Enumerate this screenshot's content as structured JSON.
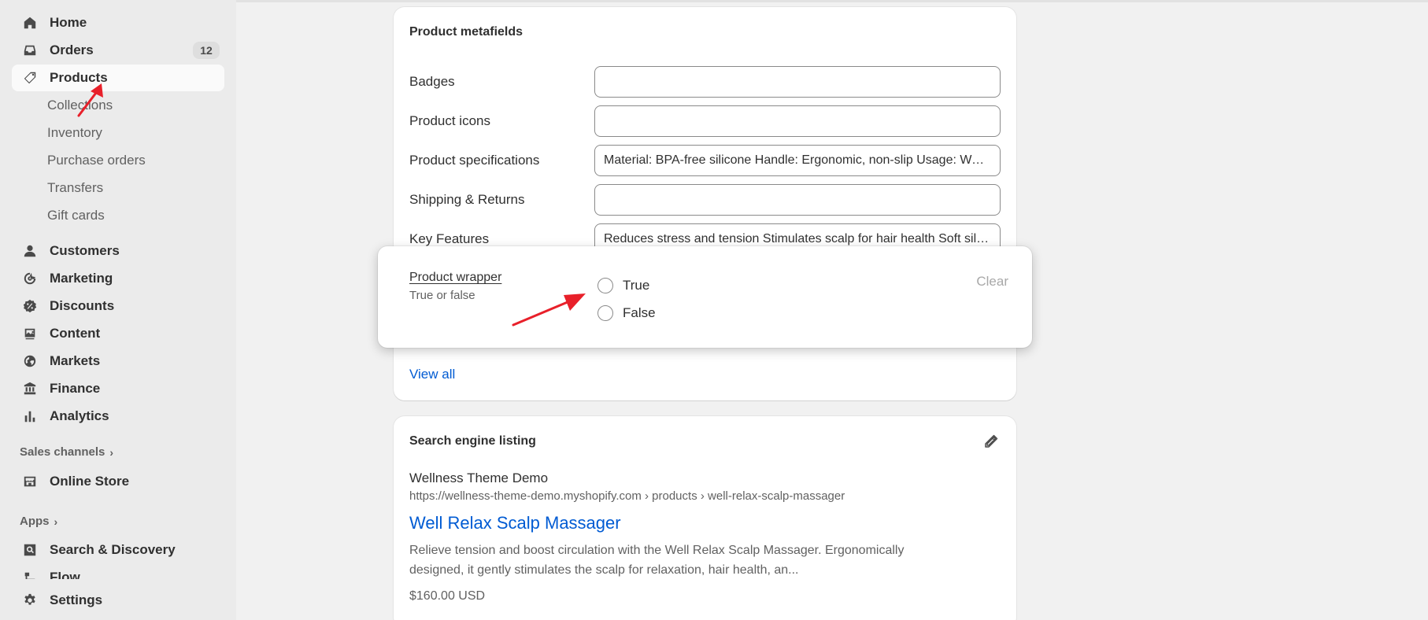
{
  "sidebar": {
    "home": "Home",
    "orders": "Orders",
    "orders_count": "12",
    "products": "Products",
    "products_sub": [
      "Collections",
      "Inventory",
      "Purchase orders",
      "Transfers",
      "Gift cards"
    ],
    "customers": "Customers",
    "marketing": "Marketing",
    "discounts": "Discounts",
    "content": "Content",
    "markets": "Markets",
    "finance": "Finance",
    "analytics": "Analytics",
    "sales_channels_label": "Sales channels",
    "online_store": "Online Store",
    "apps_label": "Apps",
    "search_discovery": "Search & Discovery",
    "flow": "Flow",
    "settings": "Settings"
  },
  "metafields": {
    "title": "Product metafields",
    "rows": [
      {
        "label": "Badges",
        "value": ""
      },
      {
        "label": "Product icons",
        "value": ""
      },
      {
        "label": "Product specifications",
        "value": "Material: BPA-free silicone Handle: Ergonomic, non-slip Usage: Wet or dry"
      },
      {
        "label": "Shipping & Returns",
        "value": ""
      },
      {
        "label": "Key Features",
        "value": "Reduces stress and tension Stimulates scalp for hair health Soft silicone bristles"
      }
    ],
    "view_all": "View all"
  },
  "popup": {
    "field_label": "Product wrapper",
    "field_type": "True or false",
    "option_true": "True",
    "option_false": "False",
    "clear": "Clear"
  },
  "seo": {
    "title": "Search engine listing",
    "store_name": "Wellness Theme Demo",
    "url": "https://wellness-theme-demo.myshopify.com › products › well-relax-scalp-massager",
    "page_title": "Well Relax Scalp Massager",
    "description_line1": "Relieve tension and boost circulation with the Well Relax Scalp Massager. Ergonomically",
    "description_line2": "designed, it gently stimulates the scalp for relaxation, hair health, an...",
    "price": "$160.00 USD"
  },
  "colors": {
    "accent": "#005bd3",
    "annotation_arrow": "#e8202a"
  }
}
